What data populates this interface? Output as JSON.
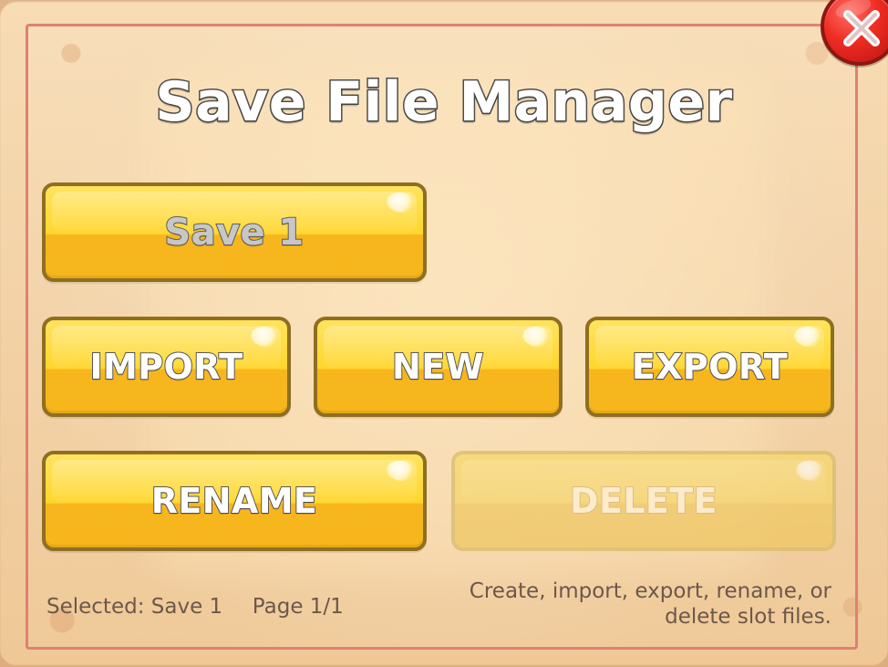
{
  "dialog": {
    "title": "Save File Manager",
    "close_label": "X"
  },
  "actions": {
    "slot": "Save 1",
    "import": "IMPORT",
    "new": "NEW",
    "export": "EXPORT",
    "rename": "RENAME",
    "delete": "DELETE"
  },
  "footer": {
    "selected": "Selected: Save 1",
    "page": "Page 1/1",
    "help_line1": "Create, import, export, rename, or",
    "help_line2": "delete slot files."
  },
  "colors": {
    "frame": "#df8174",
    "button_fill": "#ffd62c",
    "button_border": "#8e6f22",
    "close_red": "#ef2d24",
    "text": "#6c584a"
  },
  "icons": {
    "close": "close-icon"
  }
}
